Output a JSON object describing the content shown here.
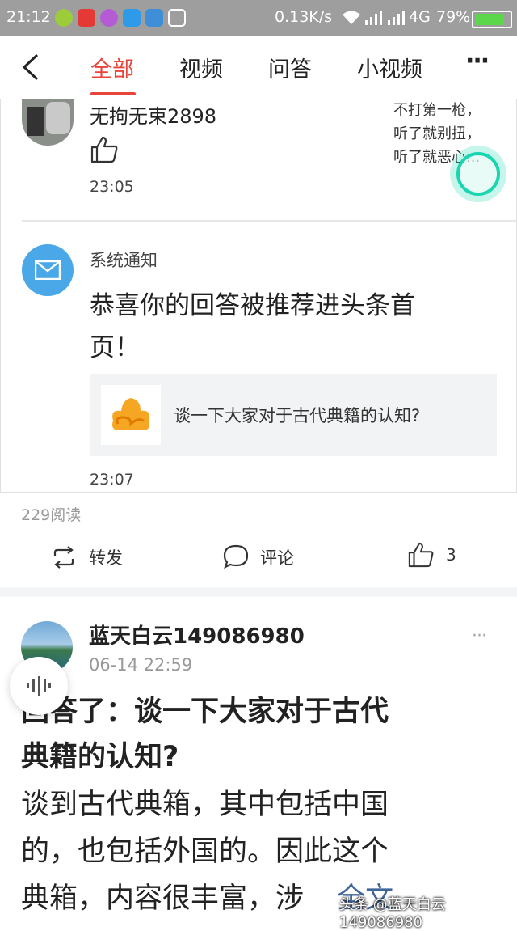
{
  "status_bar": {
    "time": "21:12",
    "net_speed": "0.13K/s",
    "network_type": "4G",
    "battery": "79%"
  },
  "tabs": {
    "items": [
      {
        "label": "全部",
        "active": true
      },
      {
        "label": "视频",
        "active": false
      },
      {
        "label": "问答",
        "active": false
      },
      {
        "label": "小视频",
        "active": false
      }
    ],
    "more": "···"
  },
  "card1": {
    "comment": {
      "username": "无拘无束2898",
      "time": "23:05",
      "snippet_lines": [
        "不打第一枪，",
        "听了就别扭，",
        "听了就恶心..."
      ]
    },
    "notice": {
      "sender": "系统通知",
      "message_line1": "恭喜你的回答被推荐进头条首",
      "message_line2": "页！",
      "question": "谈一下大家对于古代典籍的认知?",
      "time": "23:07"
    },
    "reads": "229阅读",
    "actions": {
      "forward": "转发",
      "comment": "评论",
      "like_count": "3"
    }
  },
  "card2": {
    "username": "蓝天白云149086980",
    "date": "06-14 22:59",
    "more": "···",
    "title_line1": "回答了：谈一下大家对于古代",
    "title_line2": "典籍的认知?",
    "body_line1": "谈到古代典箱，其中包括中国",
    "body_line2": "的，也包括外国的。因此这个",
    "body_line3": "典箱，内容很丰富，涉",
    "full_text": "全文"
  },
  "watermark": "头条 @蓝天白云149086980",
  "colors": {
    "accent": "#e8443a",
    "link": "#406599",
    "notice_icon": "#4aa8e8",
    "floating_ring": "#19d6b0"
  }
}
